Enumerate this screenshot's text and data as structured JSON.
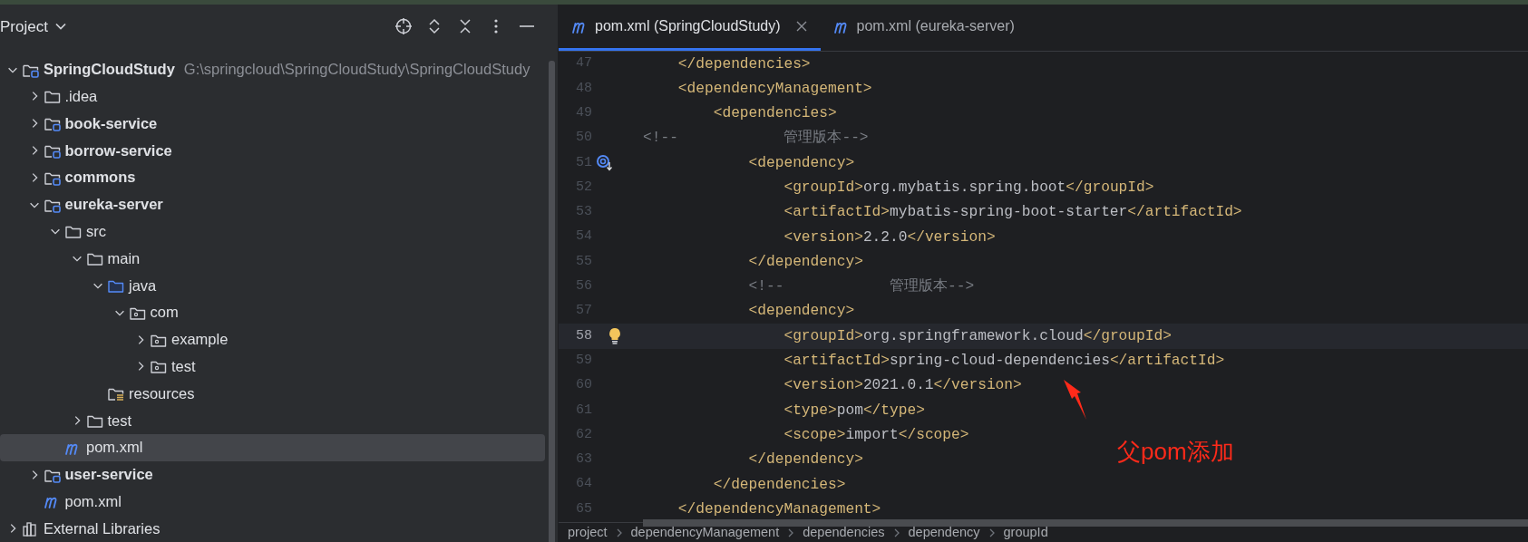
{
  "project_panel": {
    "title": "Project",
    "tree": [
      {
        "label": "SpringCloudStudy",
        "kind": "module",
        "hint": "G:\\springcloud\\SpringCloudStudy\\SpringCloudStudy",
        "expanded": true,
        "selected": false,
        "children": [
          {
            "label": ".idea",
            "kind": "folder",
            "expanded": false,
            "selected": false
          },
          {
            "label": "book-service",
            "kind": "module",
            "expanded": false,
            "selected": false
          },
          {
            "label": "borrow-service",
            "kind": "module",
            "expanded": false,
            "selected": false
          },
          {
            "label": "commons",
            "kind": "module",
            "expanded": false,
            "selected": false
          },
          {
            "label": "eureka-server",
            "kind": "module",
            "expanded": true,
            "selected": false,
            "children": [
              {
                "label": "src",
                "kind": "folder",
                "expanded": true,
                "selected": false,
                "children": [
                  {
                    "label": "main",
                    "kind": "folder",
                    "expanded": true,
                    "selected": false,
                    "children": [
                      {
                        "label": "java",
                        "kind": "source",
                        "expanded": true,
                        "selected": false,
                        "children": [
                          {
                            "label": "com",
                            "kind": "package",
                            "expanded": true,
                            "selected": false,
                            "children": [
                              {
                                "label": "example",
                                "kind": "package",
                                "expanded": false,
                                "selected": false
                              },
                              {
                                "label": "test",
                                "kind": "package",
                                "expanded": false,
                                "selected": false
                              }
                            ]
                          }
                        ]
                      },
                      {
                        "label": "resources",
                        "kind": "resources",
                        "selected": false
                      }
                    ]
                  },
                  {
                    "label": "test",
                    "kind": "folder",
                    "expanded": false,
                    "selected": false
                  }
                ]
              },
              {
                "label": "pom.xml",
                "kind": "maven",
                "selected": true
              }
            ]
          },
          {
            "label": "user-service",
            "kind": "module",
            "expanded": false,
            "selected": false
          },
          {
            "label": "pom.xml",
            "kind": "maven",
            "selected": false
          }
        ]
      },
      {
        "label": "External Libraries",
        "kind": "library",
        "expanded": false,
        "selected": false
      }
    ]
  },
  "editor": {
    "tabs": [
      {
        "label": "pom.xml (SpringCloudStudy)",
        "selected": true
      },
      {
        "label": "pom.xml (eureka-server)",
        "selected": false
      }
    ],
    "lines": [
      {
        "number": "47",
        "kind": "code",
        "text": "    </dependencies>",
        "current": false
      },
      {
        "number": "48",
        "kind": "code",
        "text": "    <dependencyManagement>",
        "current": false
      },
      {
        "number": "49",
        "kind": "code",
        "text": "        <dependencies>",
        "current": false
      },
      {
        "number": "50",
        "kind": "comment",
        "text": "<!--            管理版本-->",
        "current": false
      },
      {
        "number": "51",
        "kind": "code",
        "text": "            <dependency>",
        "current": false,
        "override_marker": true
      },
      {
        "number": "52",
        "kind": "code",
        "text": "                <groupId>org.mybatis.spring.boot</groupId>",
        "current": false
      },
      {
        "number": "53",
        "kind": "code",
        "text": "                <artifactId>mybatis-spring-boot-starter</artifactId>",
        "current": false
      },
      {
        "number": "54",
        "kind": "code",
        "text": "                <version>2.2.0</version>",
        "current": false
      },
      {
        "number": "55",
        "kind": "code",
        "text": "            </dependency>",
        "current": false
      },
      {
        "number": "56",
        "kind": "comment",
        "text": "            <!--            管理版本-->",
        "current": false
      },
      {
        "number": "57",
        "kind": "code",
        "text": "            <dependency>",
        "current": false
      },
      {
        "number": "58",
        "kind": "code",
        "text": "                <groupId>org.springframework.cloud</groupId>",
        "current": true,
        "intention_bulb": true
      },
      {
        "number": "59",
        "kind": "code",
        "text": "                <artifactId>spring-cloud-dependencies</artifactId>",
        "current": false
      },
      {
        "number": "60",
        "kind": "code",
        "text": "                <version>2021.0.1</version>",
        "current": false
      },
      {
        "number": "61",
        "kind": "code",
        "text": "                <type>pom</type>",
        "current": false
      },
      {
        "number": "62",
        "kind": "code",
        "text": "                <scope>import</scope>",
        "current": false
      },
      {
        "number": "63",
        "kind": "code",
        "text": "            </dependency>",
        "current": false
      },
      {
        "number": "64",
        "kind": "code",
        "text": "        </dependencies>",
        "current": false
      },
      {
        "number": "65",
        "kind": "code",
        "text": "    </dependencyManagement>",
        "current": false
      }
    ],
    "breadcrumbs": [
      "project",
      "dependencyManagement",
      "dependencies",
      "dependency",
      "groupId"
    ]
  },
  "annotation": {
    "text": "父pom添加"
  }
}
